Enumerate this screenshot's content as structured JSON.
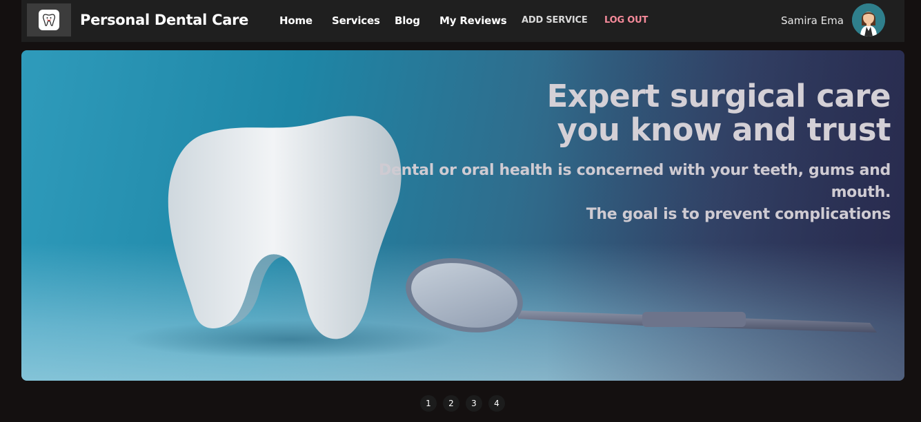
{
  "nav": {
    "brand": "Personal Dental Care",
    "links": [
      "Home",
      "Services",
      "Blog",
      "My Reviews"
    ],
    "add_service": "ADD SERVICE",
    "logout": "LOG OUT",
    "user_name": "Samira Ema"
  },
  "hero": {
    "title_line1": "Expert surgical care",
    "title_line2": "you know and trust",
    "subtitle_line1": "Dental or oral health is concerned with your teeth, gums and mouth.",
    "subtitle_line2": "The goal is to prevent complications"
  },
  "pagination": {
    "pages": [
      "1",
      "2",
      "3",
      "4"
    ]
  },
  "colors": {
    "page_bg": "#141010",
    "navbar_bg": "#1f1f1f",
    "logout": "#f58a9a"
  },
  "icons": {
    "logo": "tooth-logo-icon",
    "avatar": "user-avatar"
  }
}
